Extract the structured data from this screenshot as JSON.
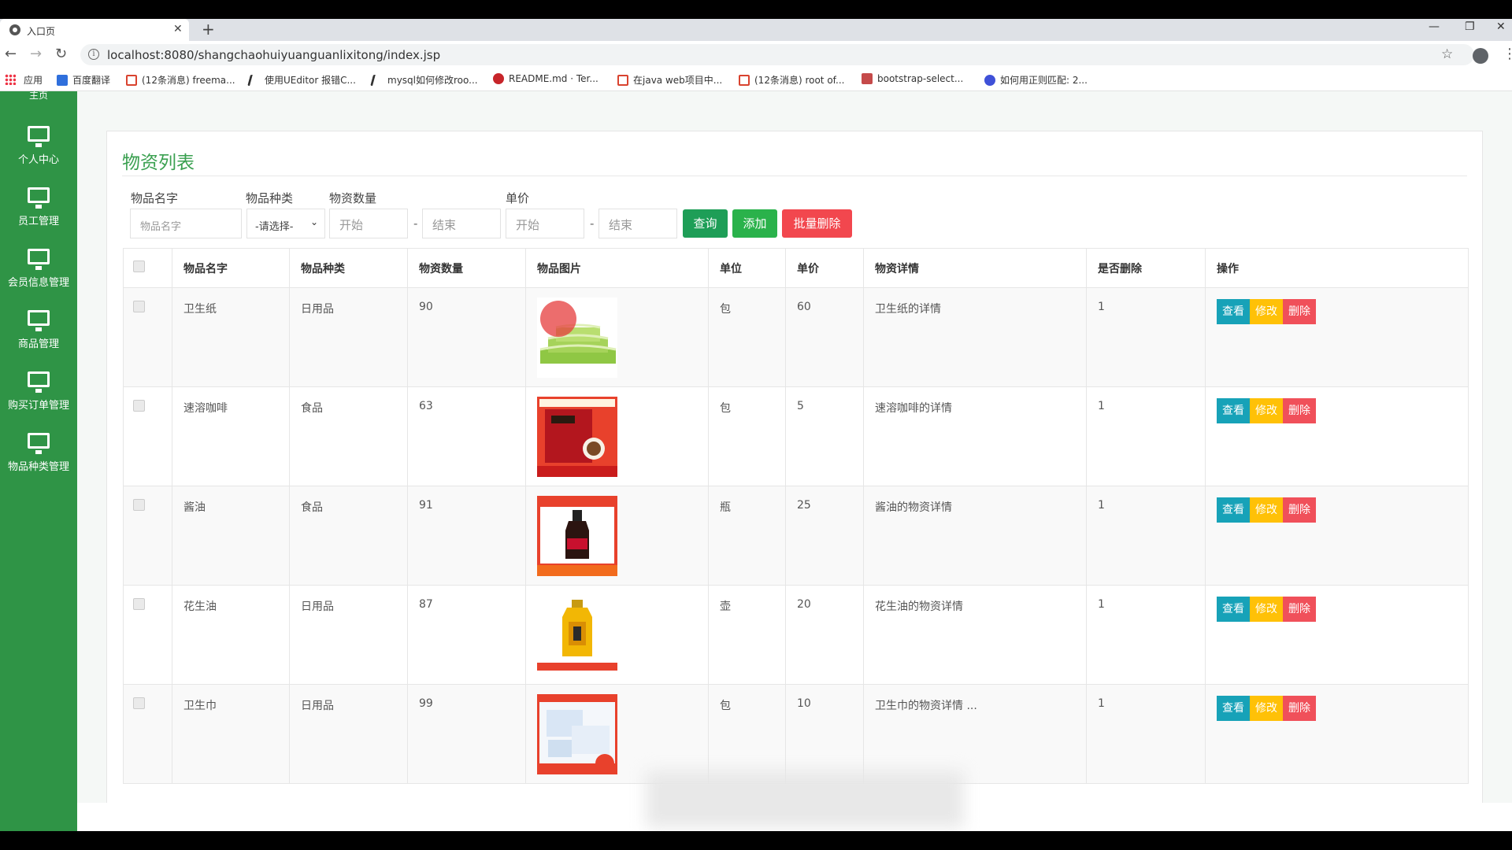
{
  "browser": {
    "tab_title": "入口页",
    "url": "localhost:8080/shangchaohuiyuanguanlixitong/index.jsp",
    "bookmarks": [
      {
        "label": "应用",
        "color": "#ffffff"
      },
      {
        "label": "百度翻译",
        "color": "#2f6fdc"
      },
      {
        "label": "(12条消息) freema...",
        "color": "#d9432f"
      },
      {
        "label": "使用UEditor 报错C...",
        "color": "#333333"
      },
      {
        "label": "mysql如何修改roo...",
        "color": "#333333"
      },
      {
        "label": "README.md · Ter...",
        "color": "#c7252a"
      },
      {
        "label": "在java web项目中...",
        "color": "#d9432f"
      },
      {
        "label": "(12条消息) root of...",
        "color": "#d9432f"
      },
      {
        "label": "bootstrap-select...",
        "color": "#c54a4a"
      },
      {
        "label": "如何用正则匹配: 2...",
        "color": "#3f51d8"
      }
    ]
  },
  "sidebar": {
    "partial_top": "主页",
    "items": [
      {
        "label": "个人中心",
        "icon": "monitor-icon"
      },
      {
        "label": "员工管理",
        "icon": "monitor-icon"
      },
      {
        "label": "会员信息管理",
        "icon": "monitor-icon"
      },
      {
        "label": "商品管理",
        "icon": "monitor-icon"
      },
      {
        "label": "购买订单管理",
        "icon": "monitor-icon"
      },
      {
        "label": "物品种类管理",
        "icon": "monitor-icon"
      }
    ]
  },
  "page": {
    "title": "物资列表"
  },
  "filters": {
    "name_label": "物品名字",
    "name_placeholder": "物品名字",
    "type_label": "物品种类",
    "type_selected": "-请选择-",
    "qty_label": "物资数量",
    "qty_start": "开始",
    "qty_end": "结束",
    "price_label": "单价",
    "price_start": "开始",
    "price_end": "结束",
    "dash": "-",
    "search_btn": "查询",
    "add_btn": "添加",
    "batch_delete_btn": "批量删除"
  },
  "table": {
    "headers": [
      "物品名字",
      "物品种类",
      "物资数量",
      "物品图片",
      "单位",
      "单价",
      "物资详情",
      "是否删除",
      "操作"
    ],
    "actions": {
      "view": "查看",
      "edit": "修改",
      "delete": "删除"
    },
    "rows": [
      {
        "name": "卫生纸",
        "type": "日用品",
        "qty": "90",
        "image": "tissue-roll-image",
        "unit": "包",
        "price": "60",
        "detail": "卫生纸的详情",
        "deleted": "1"
      },
      {
        "name": "速溶咖啡",
        "type": "食品",
        "qty": "63",
        "image": "instant-coffee-image",
        "unit": "包",
        "price": "5",
        "detail": "速溶咖啡的详情",
        "deleted": "1"
      },
      {
        "name": "酱油",
        "type": "食品",
        "qty": "91",
        "image": "soy-sauce-bottle-image",
        "unit": "瓶",
        "price": "25",
        "detail": "酱油的物资详情",
        "deleted": "1"
      },
      {
        "name": "花生油",
        "type": "日用品",
        "qty": "87",
        "image": "peanut-oil-bottle-image",
        "unit": "壶",
        "price": "20",
        "detail": "花生油的物资详情",
        "deleted": "1"
      },
      {
        "name": "卫生巾",
        "type": "日用品",
        "qty": "99",
        "image": "sanitary-pad-pack-image",
        "unit": "包",
        "price": "10",
        "detail": "卫生巾的物资详情 ...",
        "deleted": "1"
      }
    ]
  },
  "colors": {
    "sidebar": "#2f9446",
    "title": "#3aa050",
    "search": "#1e9e57",
    "add": "#2ab24b",
    "batch_delete": "#f2474e",
    "view": "#17a2b8",
    "edit": "#ffc107",
    "delete": "#f0505a"
  }
}
